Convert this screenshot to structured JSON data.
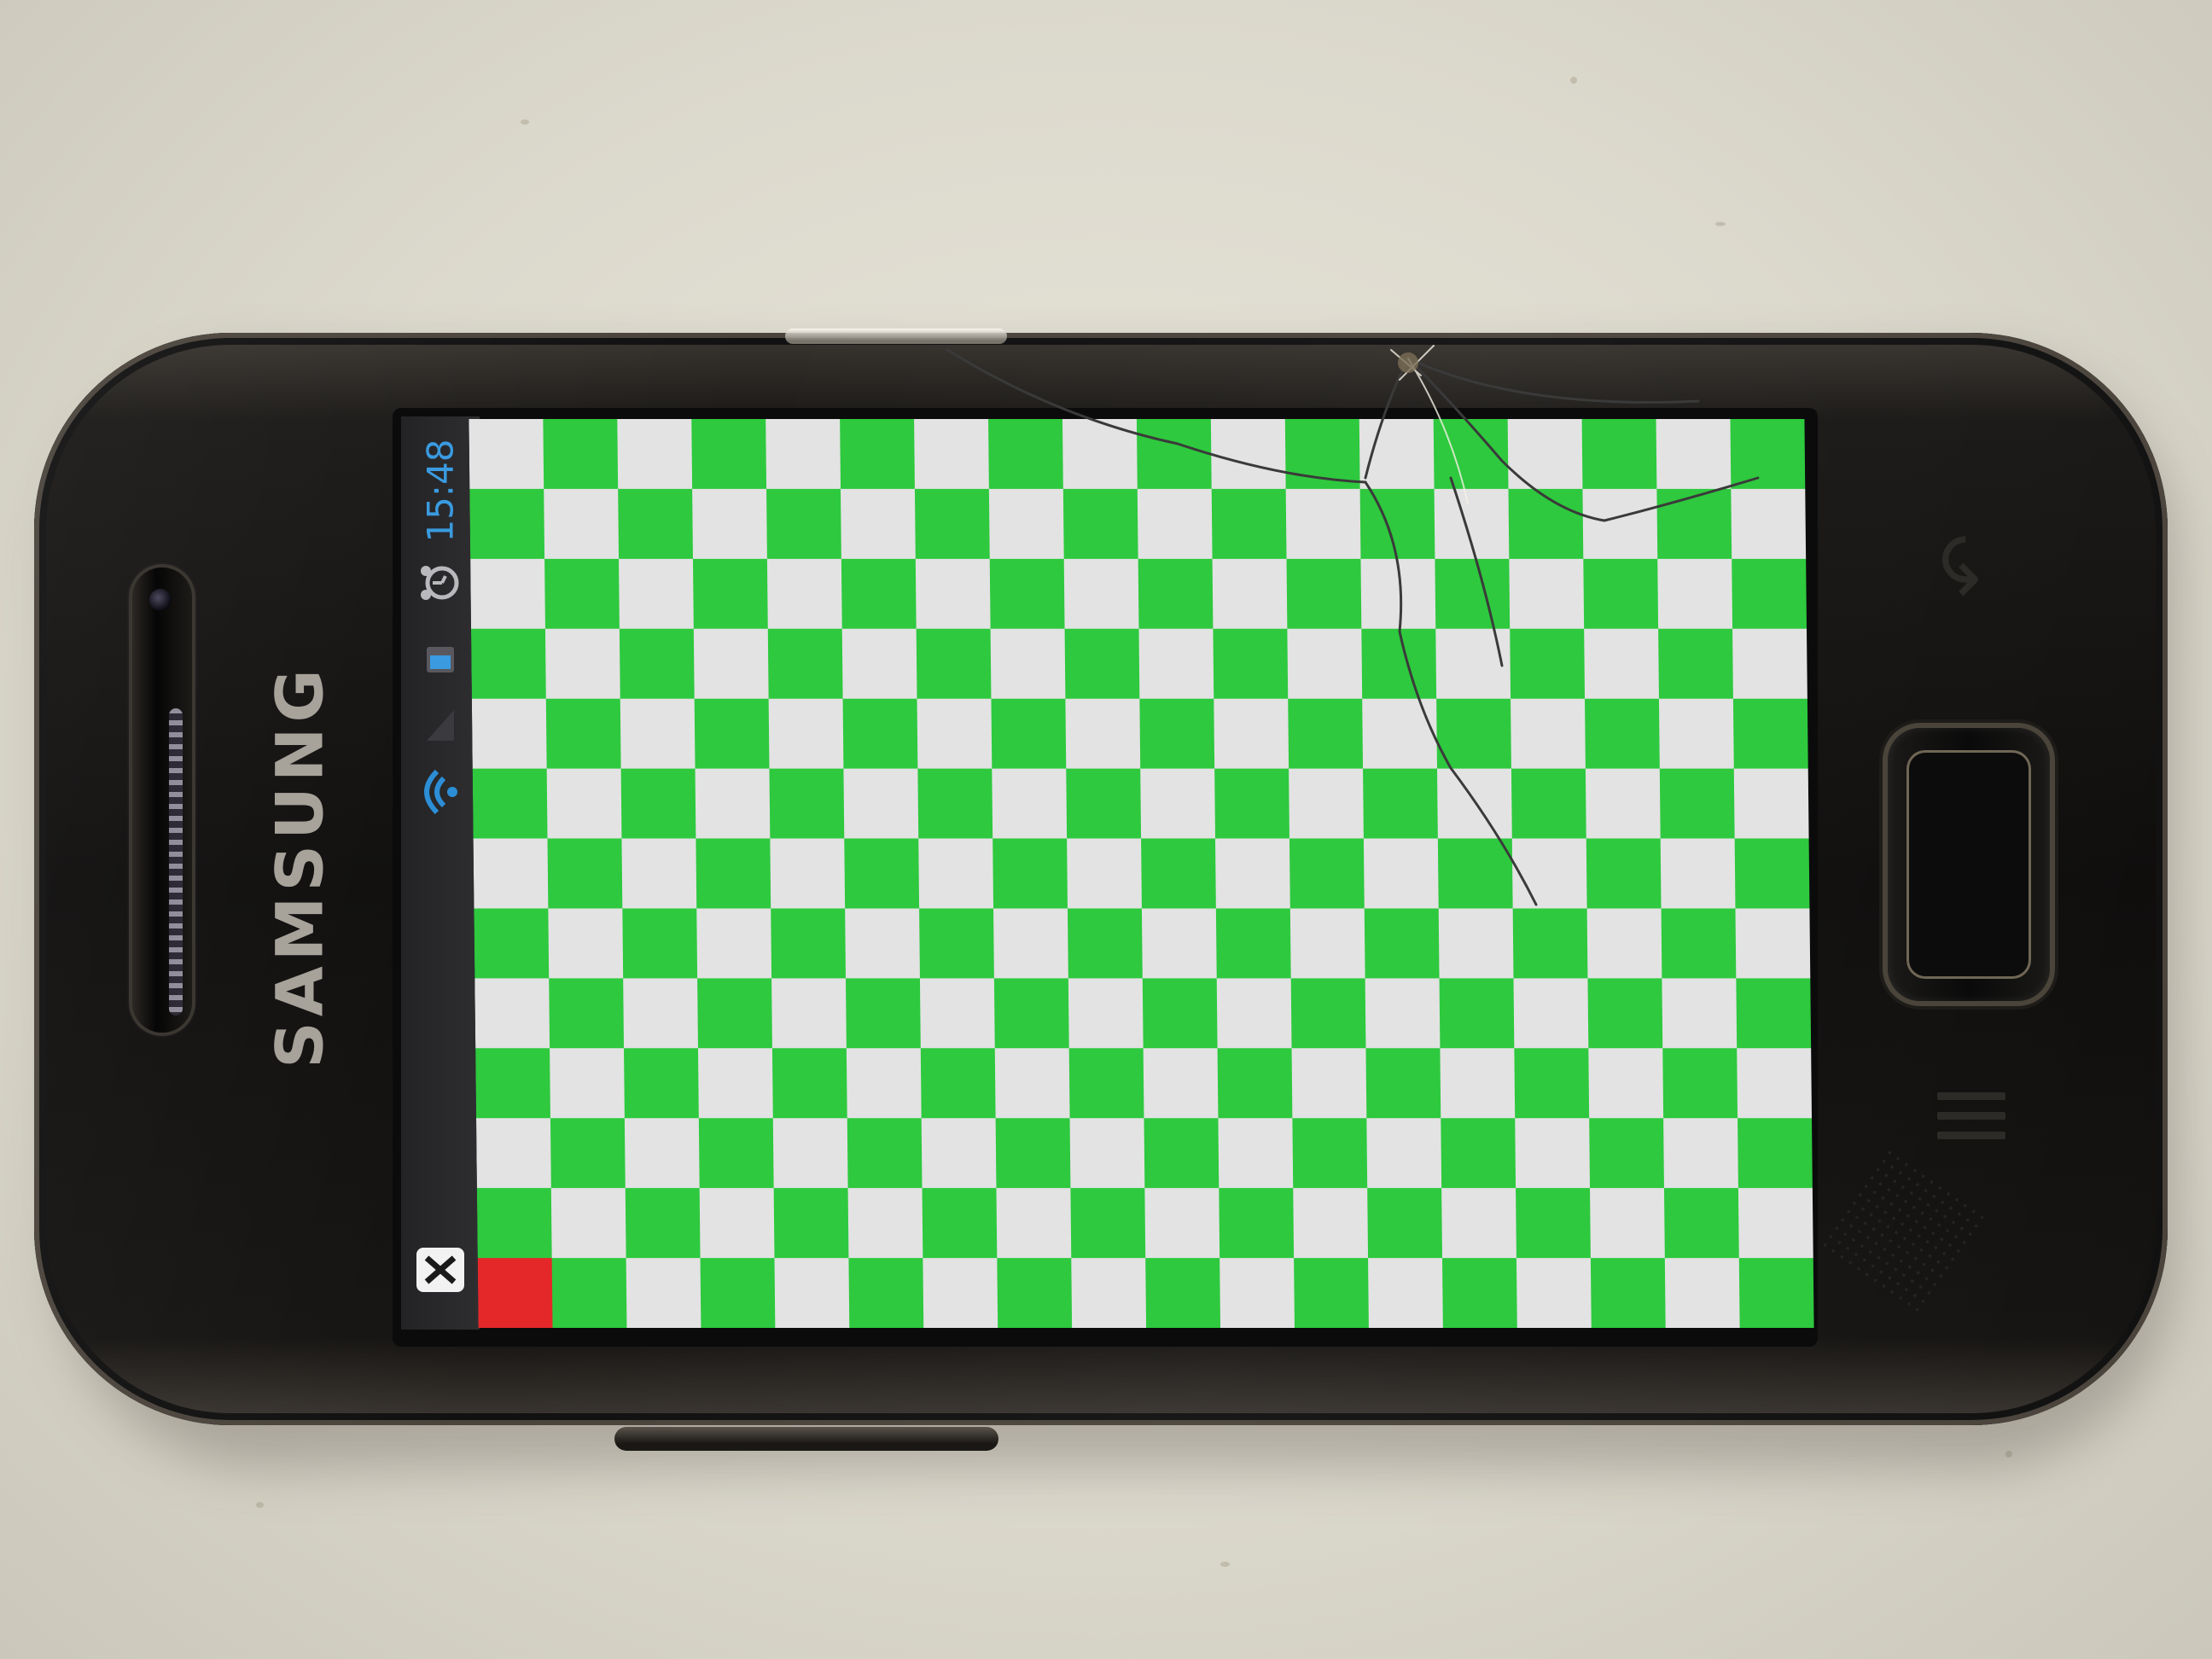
{
  "device": {
    "brand": "SAMSUNG"
  },
  "status_bar": {
    "time": "15:48",
    "icons": [
      "alarm-clock-icon",
      "battery-icon",
      "wifi-icon",
      "notification-x-icon"
    ],
    "text_color": "#3a9be0"
  },
  "screen": {
    "pattern": "checkerboard",
    "rows": 13,
    "cols": 18,
    "color_a": "#e3e3e3",
    "color_b": "#2ec93e",
    "highlight_cell": {
      "row": 12,
      "col": 0,
      "color": "#e4282a"
    }
  }
}
